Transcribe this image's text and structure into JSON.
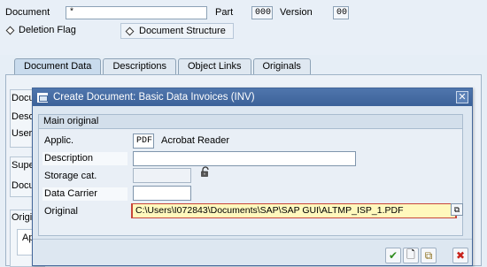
{
  "header": {
    "document_label": "Document",
    "document_value": "*",
    "part_label": "Part",
    "part_value": "000",
    "version_label": "Version",
    "version_value": "00",
    "deletion_flag_label": "Deletion Flag",
    "document_structure_label": "Document Structure"
  },
  "tabs": [
    {
      "label": "Document Data",
      "active": true
    },
    {
      "label": "Descriptions",
      "active": false
    },
    {
      "label": "Object Links",
      "active": false
    },
    {
      "label": "Originals",
      "active": false
    }
  ],
  "background_labels": {
    "docu_1": "Docum",
    "desc": "Desc",
    "user": "User",
    "supe": "Supe",
    "docu_2": "Docu",
    "origi": "Origi",
    "ap": "Ap"
  },
  "dialog": {
    "title": "Create Document: Basic Data Invoices (INV)",
    "close_symbol": "✕",
    "group_title": "Main original",
    "fields": {
      "applic_label": "Applic.",
      "applic_value": "PDF",
      "applic_desc": "Acrobat Reader",
      "description_label": "Description",
      "description_value": "",
      "storage_label": "Storage cat.",
      "storage_value": "",
      "carrier_label": "Data Carrier",
      "carrier_value": "",
      "original_label": "Original",
      "original_value": "C:\\Users\\I072843\\Documents\\SAP\\SAP GUI\\ALTMP_ISP_1.PDF"
    },
    "buttons": {
      "ok": "✔",
      "new": "🗋",
      "copy": "⧉",
      "cancel": "✖"
    }
  },
  "colors": {
    "title_bar": "#3c6299",
    "focus_field": "#fff8bd",
    "ok_green": "#2e8b1e",
    "cancel_red": "#c8231c"
  }
}
